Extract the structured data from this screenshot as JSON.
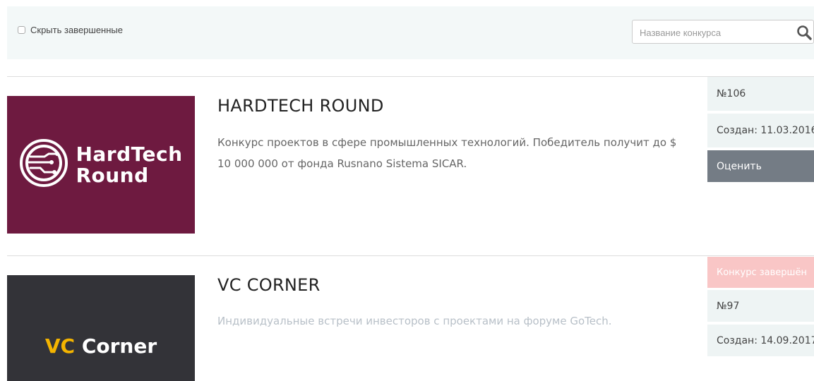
{
  "filter": {
    "hide_completed_label": "Скрыть завершенные",
    "search_placeholder": "Название конкурса"
  },
  "contests": [
    {
      "title": "HARDTECH ROUND",
      "description": "Конкурс проектов в сфере промышленных технологий. Победитель получит до $ 10 000 000 от фонда Rusnano Sistema SICAR.",
      "logo_lines": [
        "HardTech",
        "Round"
      ],
      "logo_bg": "#6e1a40",
      "number": "№106",
      "created": "Создан: 11.03.2016",
      "action_label": "Оценить"
    },
    {
      "title": "VC CORNER",
      "description": "Индивидуальные встречи инвесторов с проектами на форуме GoTech.",
      "logo_parts": [
        "VC",
        "Corner"
      ],
      "logo_bg": "#333338",
      "status": "Конкурс завершён",
      "number": "№97",
      "created": "Создан: 14.09.2017"
    }
  ],
  "colors": {
    "filter_bg": "#f3f8f8",
    "cell_bg": "#eef4f4",
    "rate_button": "#747c85",
    "ended_badge": "#f9c6c6",
    "vc_accent": "#f4b400"
  }
}
